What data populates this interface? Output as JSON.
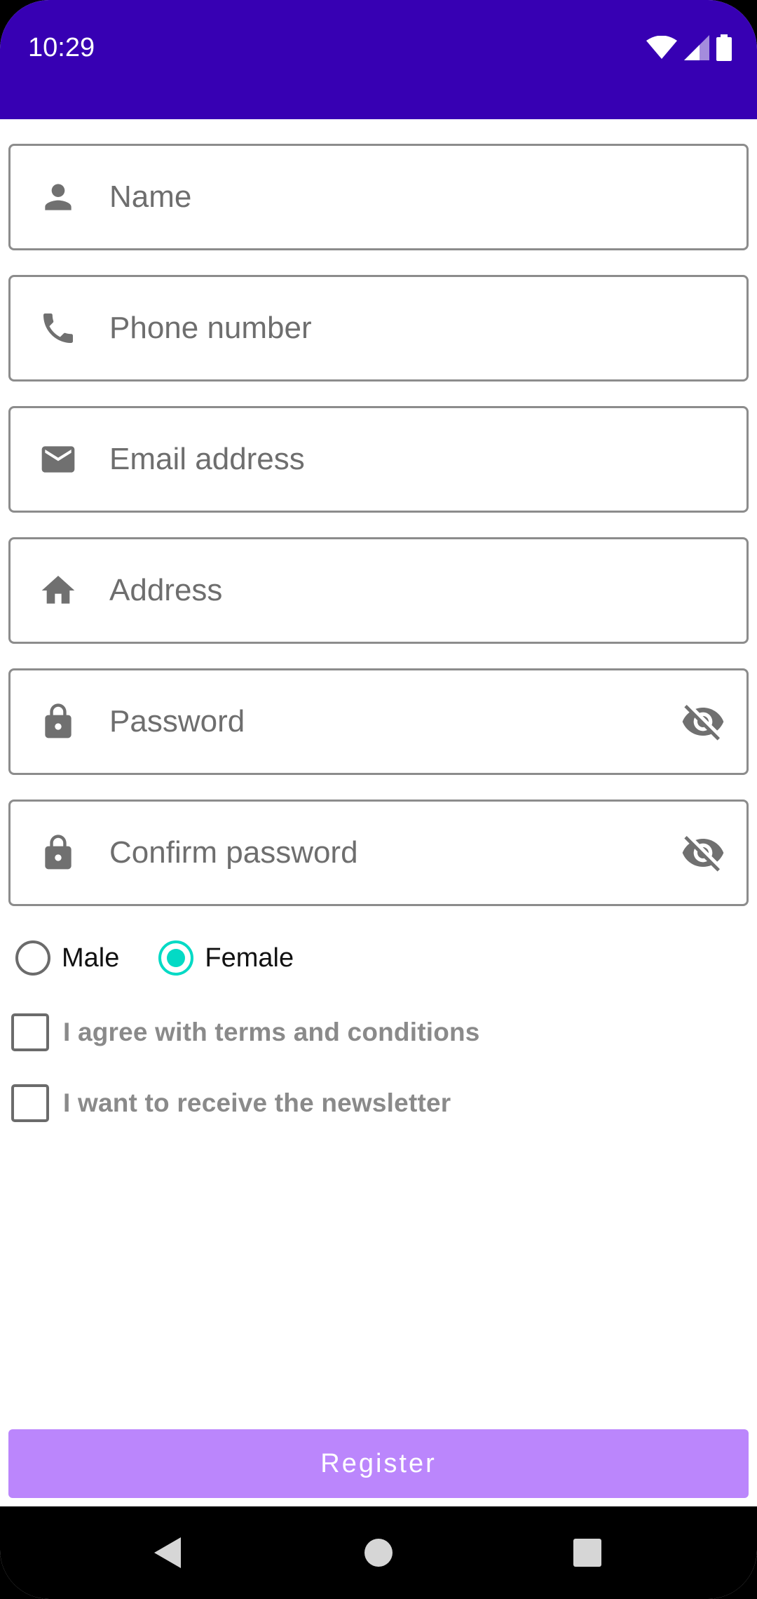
{
  "status_bar": {
    "time": "10:29",
    "color": "#3700b3"
  },
  "form": {
    "fields": [
      {
        "icon": "person-icon",
        "placeholder": "Name"
      },
      {
        "icon": "phone-icon",
        "placeholder": "Phone number"
      },
      {
        "icon": "mail-icon",
        "placeholder": "Email address"
      },
      {
        "icon": "home-icon",
        "placeholder": "Address"
      },
      {
        "icon": "lock-icon",
        "placeholder": "Password",
        "trailing_icon": "visibility-off-icon"
      },
      {
        "icon": "lock-icon",
        "placeholder": "Confirm password",
        "trailing_icon": "visibility-off-icon"
      }
    ],
    "gender": {
      "options": [
        "Male",
        "Female"
      ],
      "selected": "Female"
    },
    "checkboxes": [
      {
        "label": "I agree with terms and conditions",
        "checked": false
      },
      {
        "label": "I want to receive the newsletter",
        "checked": false
      }
    ],
    "register_label": "Register"
  },
  "colors": {
    "accent_radio": "#03dac5",
    "button": "#bb86fc",
    "field_border": "#8c8c8c"
  },
  "nav_bar": {
    "icons": [
      "back-icon",
      "home-circle-icon",
      "recents-icon"
    ]
  }
}
